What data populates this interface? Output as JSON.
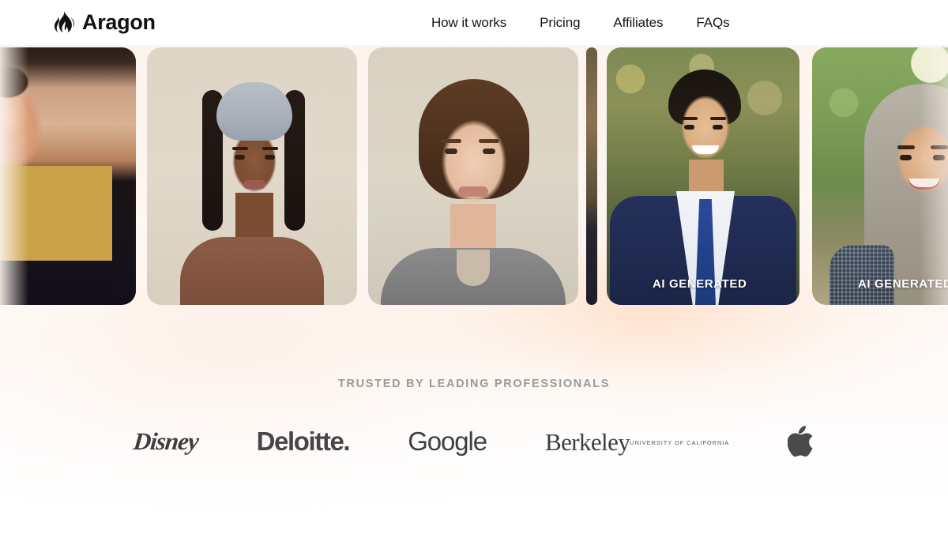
{
  "header": {
    "logo_icon": "flame-icon",
    "brand_name": "Aragon",
    "nav": [
      {
        "label": "How it works"
      },
      {
        "label": "Pricing"
      },
      {
        "label": "Affiliates"
      },
      {
        "label": "FAQs"
      }
    ]
  },
  "carousel": {
    "cards": [
      {
        "id": "card-1",
        "subject": "man in marine dress blue uniform",
        "badge": ""
      },
      {
        "id": "card-2",
        "subject": "woman with grey head wrap and braids",
        "badge": ""
      },
      {
        "id": "card-3",
        "subject": "woman with brown hair in grey henley",
        "badge": ""
      },
      {
        "id": "card-sliver",
        "subject": "partially visible card",
        "badge": ""
      },
      {
        "id": "card-4",
        "subject": "man in navy suit with blue tie",
        "badge": "AI GENERATED"
      },
      {
        "id": "card-5",
        "subject": "woman wearing grey hijab",
        "badge": "AI GENERATED"
      }
    ]
  },
  "trusted": {
    "heading": "TRUSTED BY LEADING PROFESSIONALS",
    "logos": [
      {
        "name": "Disney"
      },
      {
        "name": "Deloitte."
      },
      {
        "name": "Google"
      },
      {
        "name": "Berkeley",
        "sub": "UNIVERSITY OF CALIFORNIA"
      },
      {
        "name": "apple-logo-icon"
      }
    ]
  },
  "colors": {
    "page_background": "#fdf5ef",
    "header_background": "#ffffff",
    "brand_text": "#111215",
    "nav_text": "#15161a",
    "trusted_text": "#9a9a9c",
    "logo_text": "#46464a",
    "badge_text": "#ffffff"
  }
}
